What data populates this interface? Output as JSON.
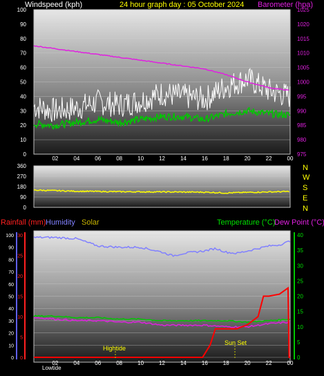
{
  "header": {
    "left_title": "Windspeed (kph)",
    "center_title": "24 hour graph day : 05 October 2024",
    "right_title": "Barometer (hpa)"
  },
  "panel3_header": {
    "rain": "Rainfall (mm)",
    "humidity": "Humidity",
    "solar": "Solar",
    "temperature": "Temperature (°C)",
    "dewpoint": "Dew Point (°C)"
  },
  "annotations": {
    "hightide": "Hightide",
    "lowtide": "Lowtide",
    "sunset": "Sun Set"
  },
  "colors": {
    "wind_avg": "#00c800",
    "wind_gust": "#ffffff",
    "barometer": "#e020e0",
    "direction": "#ffff00",
    "rain": "#ff0000",
    "humidity": "#8080ff",
    "temperature": "#00c800",
    "dewpoint": "#e020e0"
  },
  "chart_data": [
    {
      "type": "line",
      "title": "24 hour graph day : 05 October 2024",
      "x_ticks": [
        "02",
        "04",
        "06",
        "08",
        "10",
        "12",
        "14",
        "16",
        "18",
        "20",
        "22",
        "00"
      ],
      "y_left": {
        "label": "Windspeed (kph)",
        "ticks": [
          "0",
          "10",
          "20",
          "30",
          "40",
          "50",
          "60",
          "70",
          "80",
          "90",
          "100"
        ],
        "range": [
          0,
          100
        ]
      },
      "y_right": {
        "label": "Barometer (hpa)",
        "ticks": [
          "975",
          "980",
          "985",
          "990",
          "995",
          "1000",
          "1005",
          "1010",
          "1015",
          "1020",
          "1025"
        ],
        "range": [
          975,
          1025
        ]
      },
      "series": [
        {
          "name": "Windspeed (kph)",
          "hours": [
            0,
            2,
            4,
            6,
            8,
            10,
            12,
            14,
            16,
            18,
            20,
            22,
            24
          ],
          "values": [
            21,
            20,
            22,
            24,
            22,
            24,
            26,
            26,
            24,
            28,
            30,
            28,
            27
          ]
        },
        {
          "name": "Gust",
          "hours": [
            0,
            2,
            4,
            6,
            8,
            10,
            12,
            14,
            16,
            18,
            20,
            22,
            24
          ],
          "values": [
            33,
            30,
            32,
            36,
            34,
            37,
            42,
            40,
            38,
            47,
            52,
            44,
            40
          ]
        },
        {
          "name": "Barometer (hpa)",
          "hours": [
            0,
            2,
            4,
            6,
            8,
            10,
            12,
            14,
            16,
            18,
            20,
            22,
            24
          ],
          "values": [
            1012.5,
            1011.5,
            1010.5,
            1009.5,
            1008.5,
            1007.5,
            1006.5,
            1005.5,
            1004.5,
            1002.5,
            1000,
            998,
            997
          ]
        }
      ]
    },
    {
      "type": "line",
      "x_ticks": [],
      "y_left": {
        "ticks": [
          "0",
          "90",
          "180",
          "270",
          "360"
        ],
        "range": [
          0,
          360
        ]
      },
      "y_right": {
        "ticks": [
          "N",
          "W",
          "S",
          "E",
          "N"
        ]
      },
      "series": [
        {
          "name": "Direction",
          "hours": [
            0,
            2,
            4,
            6,
            8,
            10,
            12,
            14,
            16,
            18,
            20,
            22,
            24
          ],
          "values": [
            150,
            145,
            140,
            138,
            136,
            135,
            134,
            133,
            132,
            125,
            130,
            134,
            138
          ]
        }
      ]
    },
    {
      "type": "line",
      "x_ticks": [
        "02",
        "04",
        "06",
        "08",
        "10",
        "12",
        "14",
        "16",
        "18",
        "20",
        "22",
        "00"
      ],
      "y_left_rain": {
        "label": "Rainfall (mm)",
        "ticks": [
          "0",
          "5",
          "10",
          "15",
          "20",
          "25",
          "30"
        ],
        "range": [
          0,
          30
        ]
      },
      "y_left_hum": {
        "label": "Humidity",
        "ticks": [
          "0",
          "10",
          "20",
          "30",
          "40",
          "50",
          "60",
          "70",
          "80",
          "90",
          "100"
        ],
        "range": [
          0,
          100
        ]
      },
      "y_right": {
        "label": "Temperature (°C)",
        "ticks": [
          "0",
          "5",
          "10",
          "15",
          "20",
          "25",
          "30",
          "35",
          "40"
        ],
        "range": [
          0,
          40
        ]
      },
      "series": [
        {
          "name": "Humidity",
          "hours": [
            0,
            2,
            4,
            6,
            8,
            10,
            12,
            13,
            14,
            16,
            17,
            18,
            19,
            20,
            21,
            22,
            23,
            24
          ],
          "values": [
            98,
            98,
            97,
            91,
            90,
            90,
            86,
            83,
            85,
            87,
            89,
            86,
            85,
            87,
            89,
            91,
            92,
            95
          ]
        },
        {
          "name": "Temperature (°C)",
          "hours": [
            0,
            2,
            4,
            6,
            8,
            10,
            12,
            14,
            16,
            18,
            20,
            22,
            24
          ],
          "values": [
            13.5,
            13.5,
            13.0,
            13.0,
            12.5,
            12.5,
            12.0,
            12.0,
            12.0,
            12.0,
            11.5,
            12.0,
            12.5
          ]
        },
        {
          "name": "Dew Point (°C)",
          "hours": [
            0,
            2,
            4,
            6,
            8,
            10,
            12,
            14,
            16,
            18,
            20,
            22,
            24
          ],
          "values": [
            13.0,
            12.5,
            12.0,
            12.0,
            11.5,
            11.5,
            10.5,
            10.5,
            10.5,
            10.0,
            10.0,
            11.0,
            11.5
          ]
        },
        {
          "name": "Rainfall (mm)",
          "hours": [
            0,
            2,
            4,
            6,
            8,
            10,
            12,
            14,
            15.8,
            16.5,
            17,
            18,
            19,
            20,
            20.5,
            21,
            21.5,
            22,
            23,
            23.8,
            23.9,
            24
          ],
          "values": [
            0,
            0,
            0,
            0,
            0,
            0,
            0,
            0,
            0,
            3,
            7,
            7,
            7,
            8,
            9,
            10,
            15,
            15,
            15.5,
            17,
            0,
            0
          ]
        }
      ]
    }
  ]
}
